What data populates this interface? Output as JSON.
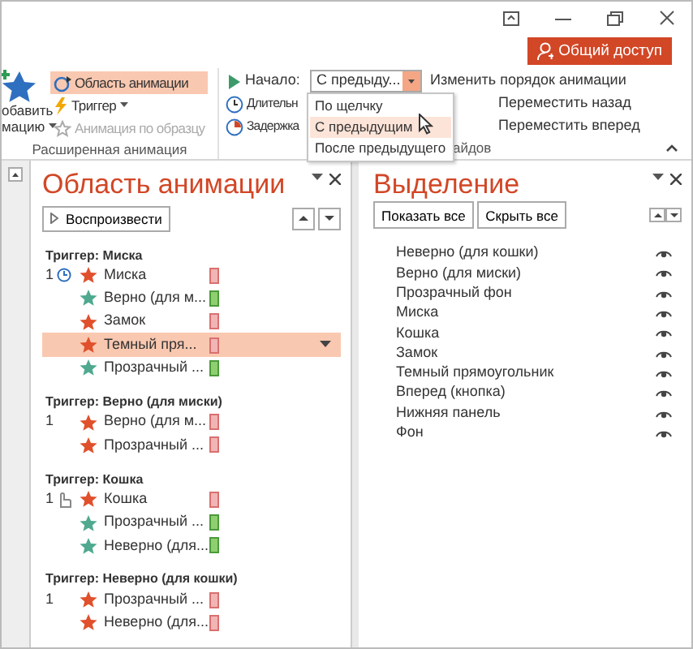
{
  "share_button": "Общий доступ",
  "ribbon": {
    "group_1": {
      "add_button": {
        "line_1": "обавить",
        "line_2": "мацию"
      },
      "items": [
        {
          "label": "Область анимации",
          "selected": true,
          "disabled": false,
          "dropdown": false,
          "kind": "pane"
        },
        {
          "label": "Триггер",
          "selected": false,
          "disabled": false,
          "dropdown": true,
          "kind": "trigger"
        },
        {
          "label": "Анимация по образцу",
          "selected": false,
          "disabled": true,
          "dropdown": false,
          "kind": "painter"
        }
      ],
      "label": "Расширенная анимация"
    },
    "group_2": {
      "start_label": "Начало:",
      "start_value": "С предыду...",
      "duration_label": "Длительн",
      "delay_label": "Задержка",
      "reorder_title": "Изменить порядок анимации",
      "move_back": "Переместить назад",
      "move_forward": "Переместить вперед",
      "label": "айдов"
    }
  },
  "start_menu": [
    {
      "label": "По щелчку",
      "selected": false
    },
    {
      "label": "С предыдущим",
      "selected": true
    },
    {
      "label": "После предыдущего",
      "selected": false
    }
  ],
  "animation_pane": {
    "title": "Область анимации",
    "play_button": "Воспроизвести",
    "groups": [
      {
        "trigger": "Триггер: Миска",
        "items": [
          {
            "order": "1",
            "clock": true,
            "kind": "exit",
            "name": "Миска",
            "selected": false
          },
          {
            "kind": "entrance",
            "name": "Верно (для м...",
            "selected": false
          },
          {
            "kind": "exit",
            "name": "Замок",
            "selected": false
          },
          {
            "kind": "exit",
            "name": "Темный пря...",
            "selected": true
          },
          {
            "kind": "entrance",
            "name": "Прозрачный ...",
            "selected": false
          }
        ]
      },
      {
        "trigger": "Триггер: Верно (для миски)",
        "items": [
          {
            "order": "1",
            "kind": "exit",
            "name": "Верно (для м...",
            "selected": false
          },
          {
            "kind": "exit",
            "name": "Прозрачный ...",
            "selected": false
          }
        ]
      },
      {
        "trigger": "Триггер: Кошка",
        "items": [
          {
            "order": "1",
            "mouse_click": true,
            "kind": "exit",
            "name": "Кошка",
            "selected": false
          },
          {
            "kind": "entrance",
            "name": "Прозрачный ...",
            "selected": false
          },
          {
            "kind": "entrance",
            "name": "Неверно (для...",
            "selected": false
          }
        ]
      },
      {
        "trigger": "Триггер: Неверно (для кошки)",
        "items": [
          {
            "order": "1",
            "kind": "exit",
            "name": "Прозрачный ...",
            "selected": false
          },
          {
            "kind": "exit",
            "name": "Неверно (для...",
            "selected": false
          }
        ]
      }
    ]
  },
  "selection_pane": {
    "title": "Выделение",
    "show_all_button": "Показать все",
    "hide_all_button": "Скрыть все",
    "items": [
      {
        "name": "Неверно (для кошки)",
        "visible": true
      },
      {
        "name": "Верно (для миски)",
        "visible": true
      },
      {
        "name": "Прозрачный фон",
        "visible": true
      },
      {
        "name": "Миска",
        "visible": true
      },
      {
        "name": "Кошка",
        "visible": true
      },
      {
        "name": "Замок",
        "visible": true
      },
      {
        "name": "Темный прямоугольник",
        "visible": true
      },
      {
        "name": "Вперед (кнопка)",
        "visible": true
      },
      {
        "name": "Нижняя панель",
        "visible": true
      },
      {
        "name": "Фон",
        "visible": true
      }
    ]
  }
}
